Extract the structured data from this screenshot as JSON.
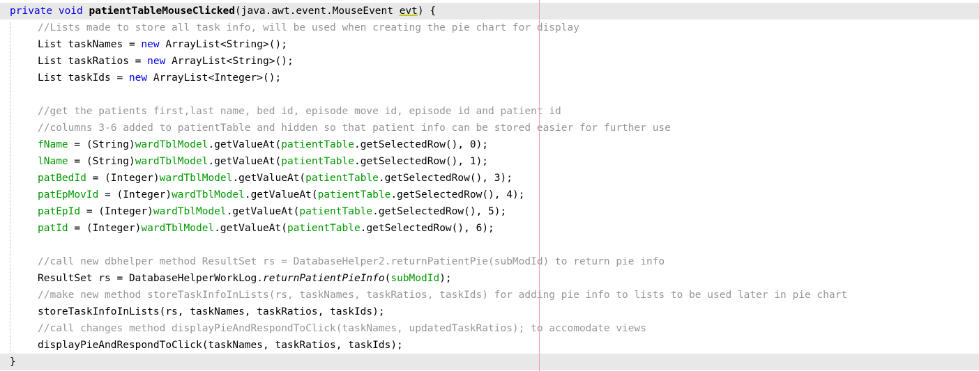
{
  "editor": {
    "lines": [
      {
        "indent": false,
        "highlight": true,
        "tokens": [
          {
            "t": "private",
            "c": "kw"
          },
          {
            "t": " ",
            "c": "ws"
          },
          {
            "t": "void",
            "c": "kw"
          },
          {
            "t": " ",
            "c": "ws"
          },
          {
            "t": "patientTableMouseClicked",
            "c": "mth"
          },
          {
            "t": "(java.awt.event.MouseEvent ",
            "c": "pl"
          },
          {
            "t": "evt",
            "c": "warn"
          },
          {
            "t": ") {",
            "c": "pl"
          }
        ]
      },
      {
        "indent": true,
        "highlight": false,
        "tokens": [
          {
            "t": "//Lists made to store all task info, will be used when creating the pie chart for display",
            "c": "cm"
          }
        ]
      },
      {
        "indent": true,
        "highlight": false,
        "tokens": [
          {
            "t": "List taskNames = ",
            "c": "pl"
          },
          {
            "t": "new",
            "c": "kw"
          },
          {
            "t": " ArrayList<String>();",
            "c": "pl"
          }
        ]
      },
      {
        "indent": true,
        "highlight": false,
        "tokens": [
          {
            "t": "List taskRatios = ",
            "c": "pl"
          },
          {
            "t": "new",
            "c": "kw"
          },
          {
            "t": " ArrayList<String>();",
            "c": "pl"
          }
        ]
      },
      {
        "indent": true,
        "highlight": false,
        "tokens": [
          {
            "t": "List taskIds = ",
            "c": "pl"
          },
          {
            "t": "new",
            "c": "kw"
          },
          {
            "t": " ArrayList<Integer>();",
            "c": "pl"
          }
        ]
      },
      {
        "indent": true,
        "highlight": false,
        "tokens": []
      },
      {
        "indent": true,
        "highlight": false,
        "tokens": [
          {
            "t": "//get the patients first,last name, bed id, episode move id, episode id and patient id",
            "c": "cm"
          }
        ]
      },
      {
        "indent": true,
        "highlight": false,
        "tokens": [
          {
            "t": "//columns 3-6 added to patientTable and hidden so that patient info can be stored easier for further use",
            "c": "cm"
          }
        ]
      },
      {
        "indent": true,
        "highlight": false,
        "tokens": [
          {
            "t": "fName",
            "c": "fld"
          },
          {
            "t": " = (String)",
            "c": "pl"
          },
          {
            "t": "wardTblModel",
            "c": "fld"
          },
          {
            "t": ".getValueAt(",
            "c": "pl"
          },
          {
            "t": "patientTable",
            "c": "fld"
          },
          {
            "t": ".getSelectedRow(), 0);",
            "c": "pl"
          }
        ]
      },
      {
        "indent": true,
        "highlight": false,
        "tokens": [
          {
            "t": "lName",
            "c": "fld"
          },
          {
            "t": " = (String)",
            "c": "pl"
          },
          {
            "t": "wardTblModel",
            "c": "fld"
          },
          {
            "t": ".getValueAt(",
            "c": "pl"
          },
          {
            "t": "patientTable",
            "c": "fld"
          },
          {
            "t": ".getSelectedRow(), 1);",
            "c": "pl"
          }
        ]
      },
      {
        "indent": true,
        "highlight": false,
        "tokens": [
          {
            "t": "patBedId",
            "c": "fld"
          },
          {
            "t": " = (Integer)",
            "c": "pl"
          },
          {
            "t": "wardTblModel",
            "c": "fld"
          },
          {
            "t": ".getValueAt(",
            "c": "pl"
          },
          {
            "t": "patientTable",
            "c": "fld"
          },
          {
            "t": ".getSelectedRow(), 3);",
            "c": "pl"
          }
        ]
      },
      {
        "indent": true,
        "highlight": false,
        "tokens": [
          {
            "t": "patEpMovId",
            "c": "fld"
          },
          {
            "t": " = (Integer)",
            "c": "pl"
          },
          {
            "t": "wardTblModel",
            "c": "fld"
          },
          {
            "t": ".getValueAt(",
            "c": "pl"
          },
          {
            "t": "patientTable",
            "c": "fld"
          },
          {
            "t": ".getSelectedRow(), 4);",
            "c": "pl"
          }
        ]
      },
      {
        "indent": true,
        "highlight": false,
        "tokens": [
          {
            "t": "patEpId",
            "c": "fld"
          },
          {
            "t": " = (Integer)",
            "c": "pl"
          },
          {
            "t": "wardTblModel",
            "c": "fld"
          },
          {
            "t": ".getValueAt(",
            "c": "pl"
          },
          {
            "t": "patientTable",
            "c": "fld"
          },
          {
            "t": ".getSelectedRow(), 5);",
            "c": "pl"
          }
        ]
      },
      {
        "indent": true,
        "highlight": false,
        "tokens": [
          {
            "t": "patId",
            "c": "fld"
          },
          {
            "t": " = (Integer)",
            "c": "pl"
          },
          {
            "t": "wardTblModel",
            "c": "fld"
          },
          {
            "t": ".getValueAt(",
            "c": "pl"
          },
          {
            "t": "patientTable",
            "c": "fld"
          },
          {
            "t": ".getSelectedRow(), 6);",
            "c": "pl"
          }
        ]
      },
      {
        "indent": true,
        "highlight": false,
        "tokens": []
      },
      {
        "indent": true,
        "highlight": false,
        "tokens": [
          {
            "t": "//call new dbhelper method ResultSet rs = DatabaseHelper2.returnPatientPie(subModId) to return pie info",
            "c": "cm"
          }
        ]
      },
      {
        "indent": true,
        "highlight": false,
        "tokens": [
          {
            "t": "ResultSet rs = DatabaseHelperWorkLog.",
            "c": "pl"
          },
          {
            "t": "returnPatientPieInfo",
            "c": "stat"
          },
          {
            "t": "(",
            "c": "pl"
          },
          {
            "t": "subModId",
            "c": "fld"
          },
          {
            "t": ");",
            "c": "pl"
          }
        ]
      },
      {
        "indent": true,
        "highlight": false,
        "tokens": [
          {
            "t": "//make new method storeTaskInfoInLists(rs, taskNames, taskRatios, taskIds) for adding pie info to lists to be used later in pie chart",
            "c": "cm"
          }
        ]
      },
      {
        "indent": true,
        "highlight": false,
        "tokens": [
          {
            "t": "storeTaskInfoInLists(rs, taskNames, taskRatios, taskIds);",
            "c": "pl"
          }
        ]
      },
      {
        "indent": true,
        "highlight": false,
        "tokens": [
          {
            "t": "//call changes method displayPieAndRespondToClick(taskNames, updatedTaskRatios); to accomodate views",
            "c": "cm"
          }
        ]
      },
      {
        "indent": true,
        "highlight": false,
        "tokens": [
          {
            "t": "displayPieAndRespondToClick(taskNames, taskRatios, taskIds);",
            "c": "pl"
          }
        ]
      },
      {
        "indent": false,
        "highlight": true,
        "tokens": [
          {
            "t": "}",
            "c": "pl"
          }
        ]
      }
    ]
  },
  "colors": {
    "keyword": "#0000e6",
    "comment": "#969696",
    "field": "#009900",
    "current_line": "#e8e8e8",
    "right_margin": "#f0a0a0"
  }
}
